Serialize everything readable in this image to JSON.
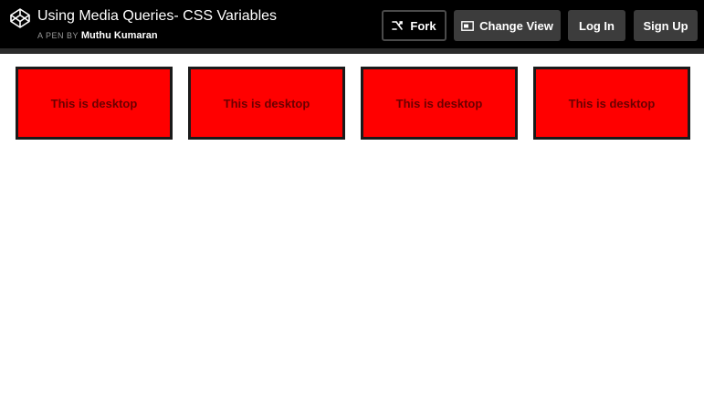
{
  "header": {
    "title": "Using Media Queries- CSS Variables",
    "byline_prefix": "A PEN BY",
    "author": "Muthu Kumaran",
    "buttons": {
      "fork": "Fork",
      "change_view": "Change View",
      "login": "Log In",
      "signup": "Sign Up"
    }
  },
  "boxes": [
    {
      "label": "This is desktop"
    },
    {
      "label": "This is desktop"
    },
    {
      "label": "This is desktop"
    },
    {
      "label": "This is desktop"
    }
  ],
  "colors": {
    "topbar": "#000000",
    "button_bg": "#3c3c3c",
    "box_fill": "#ff0000",
    "box_border": "#1a1a1a"
  },
  "icons": {
    "logo": "codepen-logo-icon",
    "fork": "fork-icon",
    "change_view": "layout-icon"
  }
}
